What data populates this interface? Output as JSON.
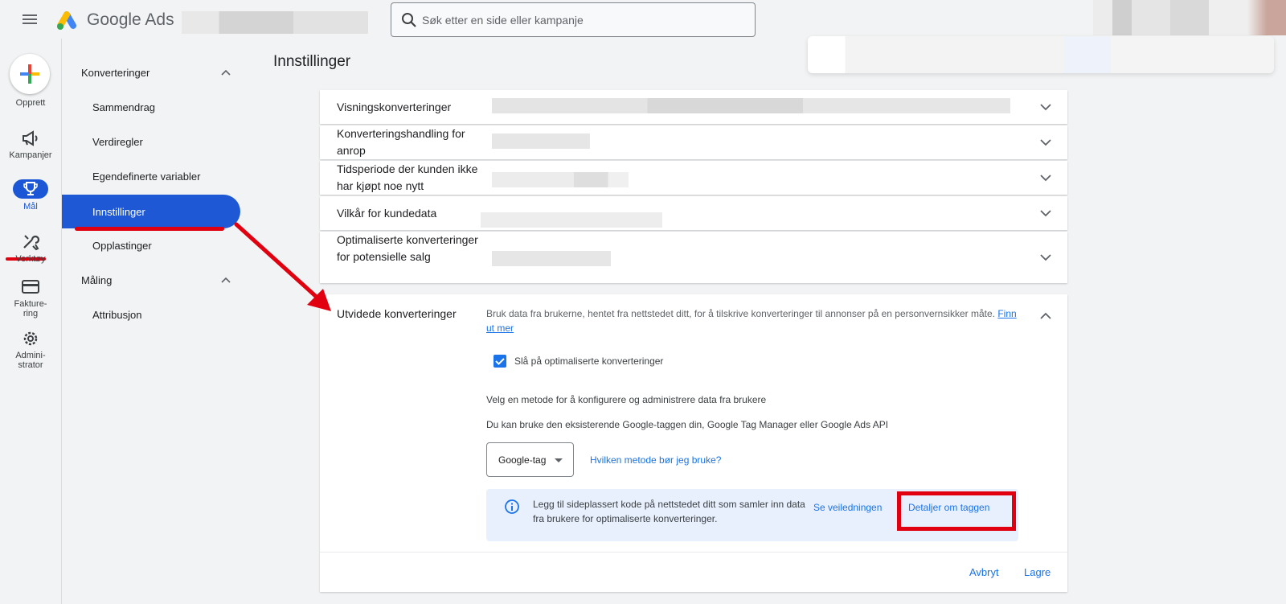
{
  "header": {
    "brand": "Google Ads",
    "search_placeholder": "Søk etter en side eller kampanje"
  },
  "rail": {
    "create": "Opprett",
    "campaigns": "Kampanjer",
    "goals": "Mål",
    "tools": "Verktøy",
    "billing_line1": "Fakture-",
    "billing_line2": "ring",
    "admin_line1": "Admini-",
    "admin_line2": "strator"
  },
  "nav": {
    "conversions": "Konverteringer",
    "summary": "Sammendrag",
    "value_rules": "Verdiregler",
    "custom_variables": "Egendefinerte variabler",
    "settings": "Innstillinger",
    "uploads": "Opplastinger",
    "measurement": "Måling",
    "attribution": "Attribusjon"
  },
  "main": {
    "title": "Innstillinger",
    "rows": [
      {
        "label": "Visningskonverteringer"
      },
      {
        "label": "Konverteringshandling for anrop"
      },
      {
        "label": "Tidsperiode der kunden ikke har kjøpt noe nytt"
      },
      {
        "label": "Vilkår for kundedata"
      },
      {
        "label": "Optimaliserte konverteringer for potensielle salg"
      }
    ],
    "panel": {
      "title": "Utvidede konverteringer",
      "description": "Bruk data fra brukerne, hentet fra nettstedet ditt, for å tilskrive konverteringer til annonser på en personvernsikker måte.",
      "learn_more": "Finn ut mer",
      "checkbox_label": "Slå på optimaliserte konverteringer",
      "line1": "Velg en metode for å konfigurere og administrere data fra brukere",
      "line2": "Du kan bruke den eksisterende Google-taggen din, Google Tag Manager eller Google Ads API",
      "method_selected": "Google-tag",
      "help_link": "Hvilken metode bør jeg bruke?",
      "info_text": "Legg til sideplassert kode på nettstedet ditt som samler inn data fra brukere for optimaliserte konverteringer.",
      "guide_link": "Se veiledningen",
      "tag_details_link": "Detaljer om taggen",
      "cancel": "Avbryt",
      "save": "Lagre"
    }
  },
  "colors": {
    "accent": "#1a73e8",
    "nav_active": "#1e58d4",
    "annotation_red": "#e0000f"
  }
}
